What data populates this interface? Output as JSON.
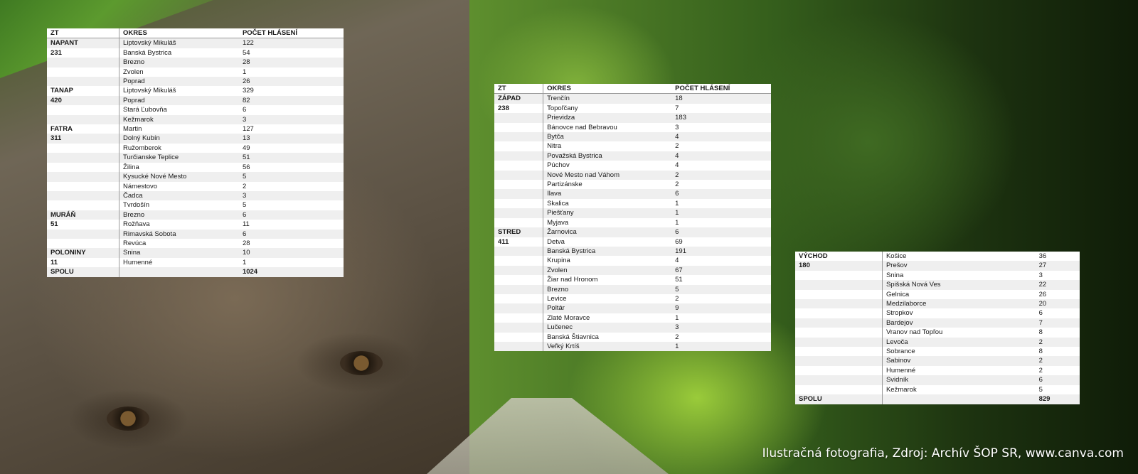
{
  "table1": {
    "headers": [
      "ZT",
      "OKRES",
      "POČET HLÁSENÍ"
    ],
    "rows": [
      [
        "NAPANT",
        "Liptovský Mikuláš",
        "122"
      ],
      [
        "231",
        "Banská Bystrica",
        "54"
      ],
      [
        "",
        "Brezno",
        "28"
      ],
      [
        "",
        "Zvolen",
        "1"
      ],
      [
        "",
        "Poprad",
        "26"
      ],
      [
        "TANAP",
        "Liptovský Mikuláš",
        "329"
      ],
      [
        "420",
        "Poprad",
        "82"
      ],
      [
        "",
        "Stará Ľubovňa",
        "6"
      ],
      [
        "",
        "Kežmarok",
        "3"
      ],
      [
        "FATRA",
        "Martin",
        "127"
      ],
      [
        "311",
        "Dolný Kubín",
        "13"
      ],
      [
        "",
        "Ružomberok",
        "49"
      ],
      [
        "",
        "Turčianske Teplice",
        "51"
      ],
      [
        "",
        "Žilina",
        "56"
      ],
      [
        "",
        "Kysucké Nové Mesto",
        "5"
      ],
      [
        "",
        "Námestovo",
        "2"
      ],
      [
        "",
        "Čadca",
        "3"
      ],
      [
        "",
        "Tvrdošín",
        "5"
      ],
      [
        "MURÁŇ",
        "Brezno",
        "6"
      ],
      [
        "51",
        "Rožňava",
        "11"
      ],
      [
        "",
        "Rimavská Sobota",
        "6"
      ],
      [
        "",
        "Revúca",
        "28"
      ],
      [
        "POLONINY",
        "Snina",
        "10"
      ],
      [
        "11",
        "Humenné",
        "1"
      ]
    ],
    "total": [
      "SPOLU",
      "",
      "1024"
    ]
  },
  "table2": {
    "headers": [
      "ZT",
      "OKRES",
      "POČET HLÁSENÍ"
    ],
    "rows": [
      [
        "ZÁPAD",
        "Trenčín",
        "18"
      ],
      [
        "238",
        "Topoľčany",
        "7"
      ],
      [
        "",
        "Prievidza",
        "183"
      ],
      [
        "",
        "Bánovce nad Bebravou",
        "3"
      ],
      [
        "",
        "Bytča",
        "4"
      ],
      [
        "",
        "Nitra",
        "2"
      ],
      [
        "",
        "Považská Bystrica",
        "4"
      ],
      [
        "",
        "Púchov",
        "4"
      ],
      [
        "",
        "Nové Mesto nad Váhom",
        "2"
      ],
      [
        "",
        "Partizánske",
        "2"
      ],
      [
        "",
        "Ilava",
        "6"
      ],
      [
        "",
        "Skalica",
        "1"
      ],
      [
        "",
        "Piešťany",
        "1"
      ],
      [
        "",
        "Myjava",
        "1"
      ],
      [
        "STRED",
        "Žarnovica",
        "6"
      ],
      [
        "411",
        "Detva",
        "69"
      ],
      [
        "",
        "Banská Bystrica",
        "191"
      ],
      [
        "",
        "Krupina",
        "4"
      ],
      [
        "",
        "Zvolen",
        "67"
      ],
      [
        "",
        "Žiar nad Hronom",
        "51"
      ],
      [
        "",
        "Brezno",
        "5"
      ],
      [
        "",
        "Levice",
        "2"
      ],
      [
        "",
        "Poltár",
        "9"
      ],
      [
        "",
        "Zlaté Moravce",
        "1"
      ],
      [
        "",
        "Lučenec",
        "3"
      ],
      [
        "",
        "Banská Štiavnica",
        "2"
      ],
      [
        "",
        "Veľký Krtíš",
        "1"
      ]
    ]
  },
  "table3": {
    "rows": [
      [
        "VÝCHOD",
        "Košice",
        "36"
      ],
      [
        "180",
        "Prešov",
        "27"
      ],
      [
        "",
        "Snina",
        "3"
      ],
      [
        "",
        "Spišská Nová Ves",
        "22"
      ],
      [
        "",
        "Gelnica",
        "26"
      ],
      [
        "",
        "Medzilaborce",
        "20"
      ],
      [
        "",
        "Stropkov",
        "6"
      ],
      [
        "",
        "Bardejov",
        "7"
      ],
      [
        "",
        "Vranov nad Topľou",
        "8"
      ],
      [
        "",
        "Levoča",
        "2"
      ],
      [
        "",
        "Sobrance",
        "8"
      ],
      [
        "",
        "Sabinov",
        "2"
      ],
      [
        "",
        "Humenné",
        "2"
      ],
      [
        "",
        "Svidník",
        "6"
      ],
      [
        "",
        "Kežmarok",
        "5"
      ]
    ],
    "total": [
      "SPOLU",
      "",
      "829"
    ]
  },
  "caption": "Ilustračná fotografia, Zdroj: Archív ŠOP SR, www.canva.com"
}
